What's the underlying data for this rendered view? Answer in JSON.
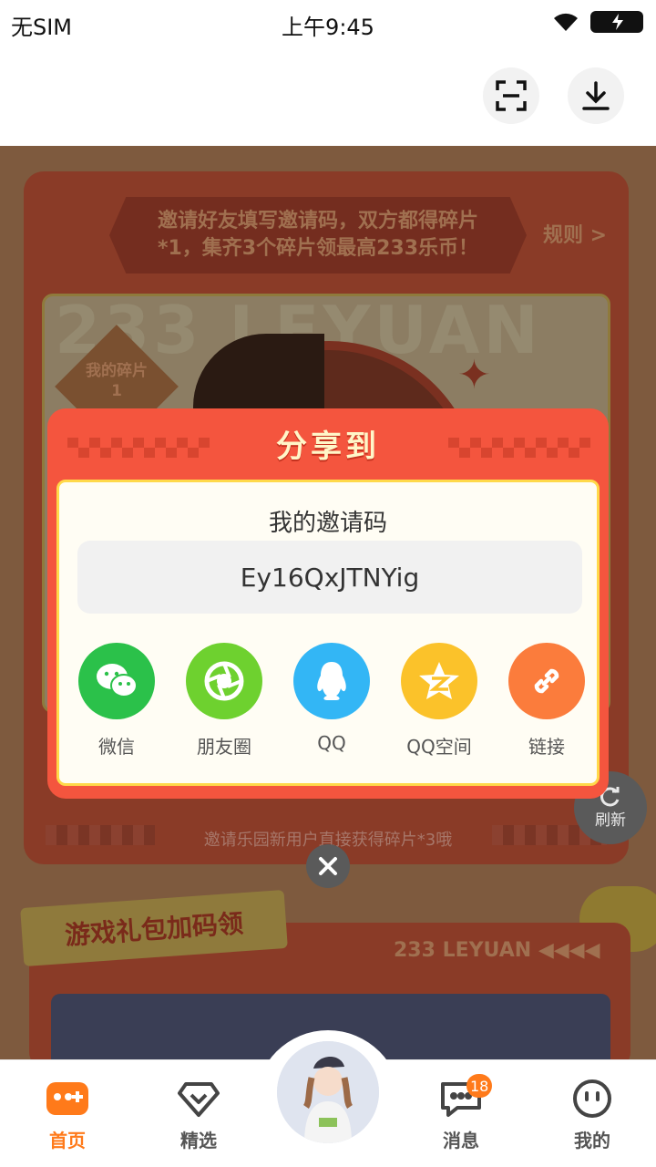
{
  "status_bar": {
    "carrier": "无SIM",
    "time": "上午9:45",
    "icons": [
      "wifi-icon",
      "battery-charging-icon"
    ]
  },
  "header": {
    "buttons": [
      {
        "icon": "scan-icon"
      },
      {
        "icon": "download-icon"
      }
    ]
  },
  "background": {
    "banner_text": "邀请好友填写邀请码，双方都得碎片*1，集齐3个碎片领最高233乐币！",
    "rule_link": "规则 >",
    "watermark_text": "233 LEYUAN",
    "fragment_badge": {
      "label": "我的碎片",
      "count": "1"
    },
    "hint": "邀请乐园新用户直接获得碎片*3哦",
    "refresh_label": "刷新",
    "section_title": "游戏礼包加码领",
    "section_brand": "233 LEYUAN"
  },
  "dialog": {
    "title": "分享到",
    "invite_label": "我的邀请码",
    "invite_code": "Ey16QxJTNYig",
    "share_targets": [
      {
        "label": "微信",
        "icon": "wechat-icon",
        "color": "#2bc14a"
      },
      {
        "label": "朋友圈",
        "icon": "moments-icon",
        "color": "#6ed12f"
      },
      {
        "label": "QQ",
        "icon": "qq-icon",
        "color": "#33b6f5"
      },
      {
        "label": "QQ空间",
        "icon": "qzone-icon",
        "color": "#fbc22a"
      },
      {
        "label": "链接",
        "icon": "link-icon",
        "color": "#fb7c3c"
      }
    ]
  },
  "tabbar": {
    "tabs": [
      {
        "label": "首页",
        "icon": "gamepad-icon",
        "active": true
      },
      {
        "label": "精选",
        "icon": "heart-diamond-icon",
        "active": false
      },
      {
        "label": "消息",
        "icon": "message-icon",
        "active": false,
        "badge": "18"
      },
      {
        "label": "我的",
        "icon": "profile-face-icon",
        "active": false
      }
    ]
  },
  "colors": {
    "accent": "#ff7a1a",
    "dialog_red": "#f4553e",
    "dialog_border": "#ffd94a"
  }
}
